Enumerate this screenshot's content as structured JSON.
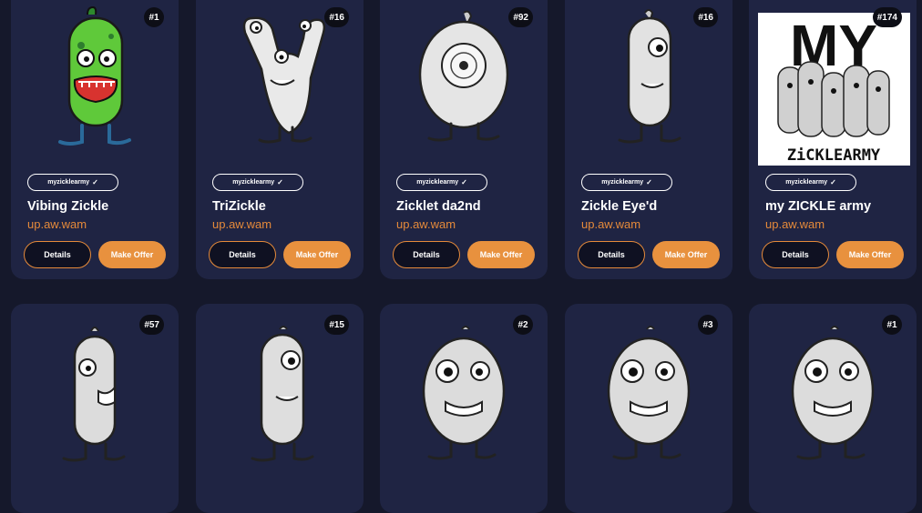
{
  "cards": [
    {
      "badge": "#1",
      "collection": "myzicklearmy",
      "name": "Vibing Zickle",
      "owner": "up.aw.wam",
      "details": "Details",
      "offer": "Make Offer"
    },
    {
      "badge": "#16",
      "collection": "myzicklearmy",
      "name": "TriZickle",
      "owner": "up.aw.wam",
      "details": "Details",
      "offer": "Make Offer"
    },
    {
      "badge": "#92",
      "collection": "myzicklearmy",
      "name": "Zicklet da2nd",
      "owner": "up.aw.wam",
      "details": "Details",
      "offer": "Make Offer"
    },
    {
      "badge": "#16",
      "collection": "myzicklearmy",
      "name": "Zickle Eye'd",
      "owner": "up.aw.wam",
      "details": "Details",
      "offer": "Make Offer"
    },
    {
      "badge": "#174",
      "collection": "myzicklearmy",
      "name": "my ZICKLE army",
      "owner": "up.aw.wam",
      "details": "Details",
      "offer": "Make Offer",
      "poster_title": "MY",
      "poster_caption": "ZiCKLEARMY"
    },
    {
      "badge": "#57"
    },
    {
      "badge": "#15"
    },
    {
      "badge": "#2"
    },
    {
      "badge": "#3"
    },
    {
      "badge": "#1"
    }
  ],
  "colors": {
    "accent": "#e8913e",
    "card": "#1f2443",
    "background": "#15182b"
  }
}
